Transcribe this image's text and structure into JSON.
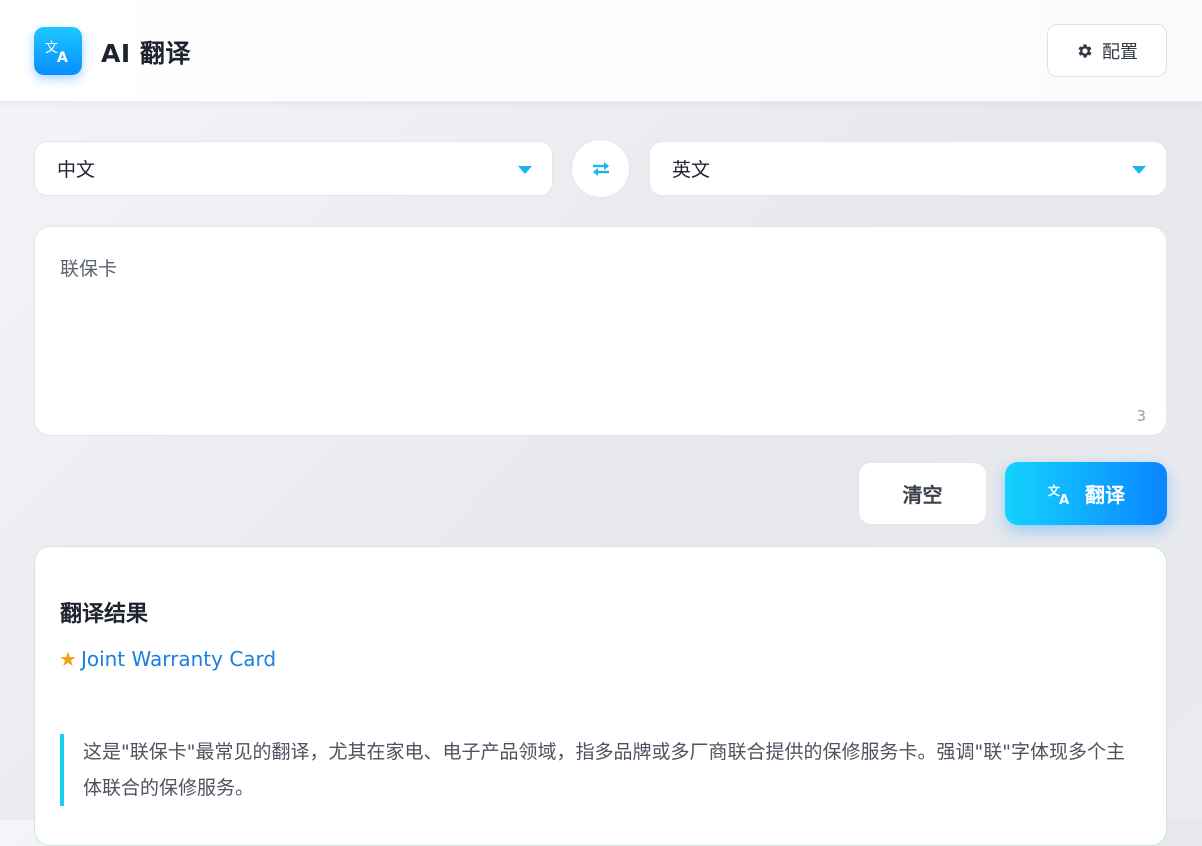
{
  "header": {
    "app_title": "AI 翻译",
    "logo_icon": "translate-icon",
    "config_label": "配置",
    "config_icon": "gear-icon"
  },
  "languages": {
    "source": "中文",
    "target": "英文",
    "swap_icon": "swap-icon"
  },
  "input": {
    "value": "联保卡",
    "char_count": "3"
  },
  "actions": {
    "clear_label": "清空",
    "translate_label": "翻译",
    "translate_icon": "translate-icon"
  },
  "result": {
    "title": "翻译结果",
    "primary_translation": "Joint Warranty Card",
    "star_icon": "star-icon",
    "note": "这是\"联保卡\"最常见的翻译，尤其在家电、电子产品领域，指多品牌或多厂商联合提供的保修服务卡。强调\"联\"字体现多个主体联合的保修服务。"
  },
  "colors": {
    "accent": "#0a8dff",
    "accent_light": "#13d3ff",
    "caret": "#17b8e8",
    "star": "#f0a31a",
    "result_link": "#1a7fe0"
  }
}
